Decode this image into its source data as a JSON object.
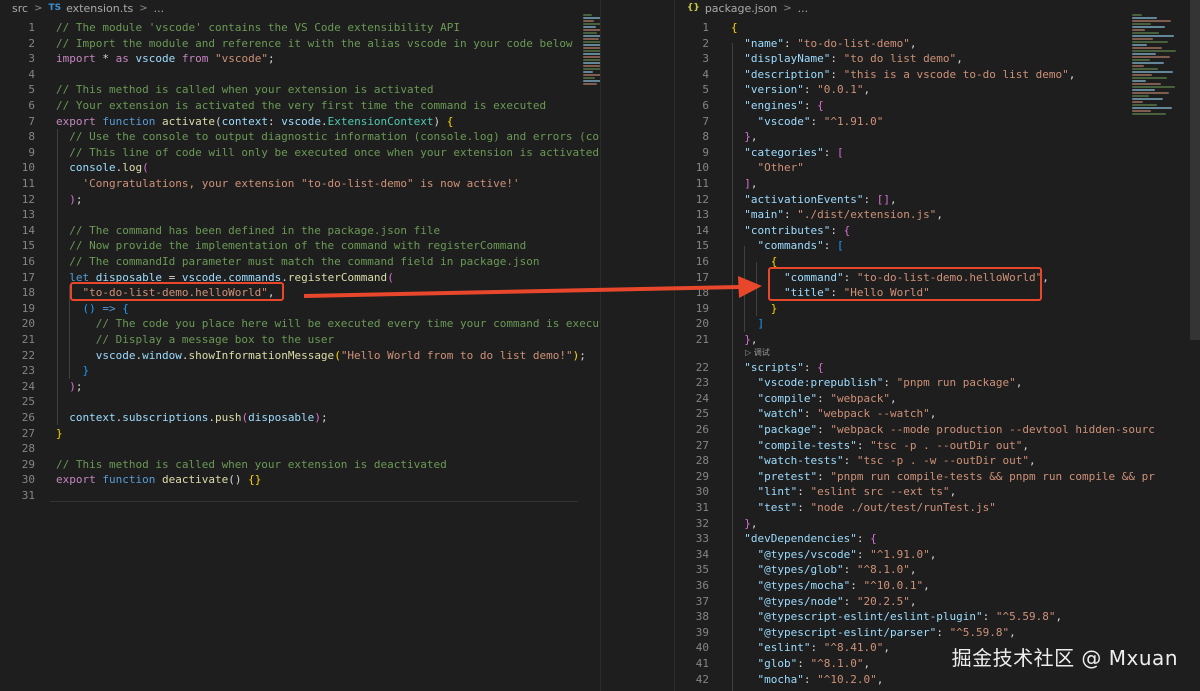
{
  "left": {
    "breadcrumb": {
      "folder": "src",
      "lang": "TS",
      "file": "extension.ts",
      "more": "..."
    },
    "lines": [
      {
        "n": "1",
        "tokens": [
          [
            "c",
            "// The module 'vscode' contains the VS Code extensibility API"
          ]
        ]
      },
      {
        "n": "2",
        "tokens": [
          [
            "c",
            "// Import the module and reference it with the alias vscode in your code below"
          ]
        ]
      },
      {
        "n": "3",
        "tokens": [
          [
            "k2",
            "import"
          ],
          [
            "p",
            " * "
          ],
          [
            "k2",
            "as"
          ],
          [
            "v",
            " vscode "
          ],
          [
            "k2",
            "from"
          ],
          [
            "s",
            " \"vscode\""
          ],
          [
            "p",
            ";"
          ]
        ]
      },
      {
        "n": "4",
        "tokens": []
      },
      {
        "n": "5",
        "tokens": [
          [
            "c",
            "// This method is called when your extension is activated"
          ]
        ]
      },
      {
        "n": "6",
        "tokens": [
          [
            "c",
            "// Your extension is activated the very first time the command is executed"
          ]
        ]
      },
      {
        "n": "7",
        "tokens": [
          [
            "k2",
            "export"
          ],
          [
            "k",
            " function"
          ],
          [
            "f",
            " activate"
          ],
          [
            "p",
            "("
          ],
          [
            "v",
            "context"
          ],
          [
            "p",
            ": "
          ],
          [
            "v",
            "vscode"
          ],
          [
            "p",
            "."
          ],
          [
            "t",
            "ExtensionContext"
          ],
          [
            "p",
            ") "
          ],
          [
            "b1",
            "{"
          ]
        ]
      },
      {
        "n": "8",
        "tokens": [
          [
            "c",
            "  // Use the console to output diagnostic information (console.log) and errors (cons"
          ]
        ]
      },
      {
        "n": "9",
        "tokens": [
          [
            "c",
            "  // This line of code will only be executed once when your extension is activated"
          ]
        ]
      },
      {
        "n": "10",
        "tokens": [
          [
            "v",
            "  console"
          ],
          [
            "p",
            "."
          ],
          [
            "f",
            "log"
          ],
          [
            "b2",
            "("
          ]
        ]
      },
      {
        "n": "11",
        "tokens": [
          [
            "s",
            "    'Congratulations, your extension \"to-do-list-demo\" is now active!'"
          ]
        ]
      },
      {
        "n": "12",
        "tokens": [
          [
            "b2",
            "  )"
          ],
          [
            "p",
            ";"
          ]
        ]
      },
      {
        "n": "13",
        "tokens": []
      },
      {
        "n": "14",
        "tokens": [
          [
            "c",
            "  // The command has been defined in the package.json file"
          ]
        ]
      },
      {
        "n": "15",
        "tokens": [
          [
            "c",
            "  // Now provide the implementation of the command with registerCommand"
          ]
        ]
      },
      {
        "n": "16",
        "tokens": [
          [
            "c",
            "  // The commandId parameter must match the command field in package.json"
          ]
        ]
      },
      {
        "n": "17",
        "tokens": [
          [
            "k",
            "  let"
          ],
          [
            "v",
            " disposable"
          ],
          [
            "p",
            " = "
          ],
          [
            "v",
            "vscode"
          ],
          [
            "p",
            "."
          ],
          [
            "v",
            "commands"
          ],
          [
            "p",
            "."
          ],
          [
            "f",
            "registerCommand"
          ],
          [
            "b2",
            "("
          ]
        ]
      },
      {
        "n": "18",
        "tokens": [
          [
            "s",
            "    \"to-do-list-demo.helloWorld\""
          ],
          [
            "p",
            ","
          ]
        ]
      },
      {
        "n": "19",
        "tokens": [
          [
            "b3",
            "    ()"
          ],
          [
            "k",
            " =>"
          ],
          [
            "b3",
            " {"
          ]
        ]
      },
      {
        "n": "20",
        "tokens": [
          [
            "c",
            "      // The code you place here will be executed every time your command is execute"
          ]
        ]
      },
      {
        "n": "21",
        "tokens": [
          [
            "c",
            "      // Display a message box to the user"
          ]
        ]
      },
      {
        "n": "22",
        "tokens": [
          [
            "v",
            "      vscode"
          ],
          [
            "p",
            "."
          ],
          [
            "v",
            "window"
          ],
          [
            "p",
            "."
          ],
          [
            "f",
            "showInformationMessage"
          ],
          [
            "b1",
            "("
          ],
          [
            "s",
            "\"Hello World from to do list demo!\""
          ],
          [
            "b1",
            ")"
          ],
          [
            "p",
            ";"
          ]
        ]
      },
      {
        "n": "23",
        "tokens": [
          [
            "b3",
            "    }"
          ]
        ]
      },
      {
        "n": "24",
        "tokens": [
          [
            "b2",
            "  )"
          ],
          [
            "p",
            ";"
          ]
        ]
      },
      {
        "n": "25",
        "tokens": []
      },
      {
        "n": "26",
        "tokens": [
          [
            "v",
            "  context"
          ],
          [
            "p",
            "."
          ],
          [
            "v",
            "subscriptions"
          ],
          [
            "p",
            "."
          ],
          [
            "f",
            "push"
          ],
          [
            "b2",
            "("
          ],
          [
            "v",
            "disposable"
          ],
          [
            "b2",
            ")"
          ],
          [
            "p",
            ";"
          ]
        ]
      },
      {
        "n": "27",
        "tokens": [
          [
            "b1",
            "}"
          ]
        ]
      },
      {
        "n": "28",
        "tokens": []
      },
      {
        "n": "29",
        "tokens": [
          [
            "c",
            "// This method is called when your extension is deactivated"
          ]
        ]
      },
      {
        "n": "30",
        "tokens": [
          [
            "k2",
            "export"
          ],
          [
            "k",
            " function"
          ],
          [
            "f",
            " deactivate"
          ],
          [
            "p",
            "() "
          ],
          [
            "b1",
            "{}"
          ]
        ]
      },
      {
        "n": "31",
        "tokens": []
      }
    ]
  },
  "right": {
    "breadcrumb": {
      "lang": "{}",
      "file": "package.json",
      "more": "..."
    },
    "codelens": "▷ 调试",
    "lines": [
      {
        "n": "1",
        "tokens": [
          [
            "b1",
            "{"
          ]
        ]
      },
      {
        "n": "2",
        "tokens": [
          [
            "y",
            "  \"name\""
          ],
          [
            "p",
            ": "
          ],
          [
            "s",
            "\"to-do-list-demo\""
          ],
          [
            "p",
            ","
          ]
        ]
      },
      {
        "n": "3",
        "tokens": [
          [
            "y",
            "  \"displayName\""
          ],
          [
            "p",
            ": "
          ],
          [
            "s",
            "\"to do list demo\""
          ],
          [
            "p",
            ","
          ]
        ]
      },
      {
        "n": "4",
        "tokens": [
          [
            "y",
            "  \"description\""
          ],
          [
            "p",
            ": "
          ],
          [
            "s",
            "\"this is a vscode to-do list demo\""
          ],
          [
            "p",
            ","
          ]
        ]
      },
      {
        "n": "5",
        "tokens": [
          [
            "y",
            "  \"version\""
          ],
          [
            "p",
            ": "
          ],
          [
            "s",
            "\"0.0.1\""
          ],
          [
            "p",
            ","
          ]
        ]
      },
      {
        "n": "6",
        "tokens": [
          [
            "y",
            "  \"engines\""
          ],
          [
            "p",
            ": "
          ],
          [
            "b2",
            "{"
          ]
        ]
      },
      {
        "n": "7",
        "tokens": [
          [
            "y",
            "    \"vscode\""
          ],
          [
            "p",
            ": "
          ],
          [
            "s",
            "\"^1.91.0\""
          ]
        ]
      },
      {
        "n": "8",
        "tokens": [
          [
            "b2",
            "  }"
          ],
          [
            "p",
            ","
          ]
        ]
      },
      {
        "n": "9",
        "tokens": [
          [
            "y",
            "  \"categories\""
          ],
          [
            "p",
            ": "
          ],
          [
            "b2",
            "["
          ]
        ]
      },
      {
        "n": "10",
        "tokens": [
          [
            "s",
            "    \"Other\""
          ]
        ]
      },
      {
        "n": "11",
        "tokens": [
          [
            "b2",
            "  ]"
          ],
          [
            "p",
            ","
          ]
        ]
      },
      {
        "n": "12",
        "tokens": [
          [
            "y",
            "  \"activationEvents\""
          ],
          [
            "p",
            ": "
          ],
          [
            "b2",
            "[]"
          ],
          [
            "p",
            ","
          ]
        ]
      },
      {
        "n": "13",
        "tokens": [
          [
            "y",
            "  \"main\""
          ],
          [
            "p",
            ": "
          ],
          [
            "s",
            "\"./dist/extension.js\""
          ],
          [
            "p",
            ","
          ]
        ]
      },
      {
        "n": "14",
        "tokens": [
          [
            "y",
            "  \"contributes\""
          ],
          [
            "p",
            ": "
          ],
          [
            "b2",
            "{"
          ]
        ]
      },
      {
        "n": "15",
        "tokens": [
          [
            "y",
            "    \"commands\""
          ],
          [
            "p",
            ": "
          ],
          [
            "b3",
            "["
          ]
        ]
      },
      {
        "n": "16",
        "tokens": [
          [
            "b1",
            "      {"
          ]
        ]
      },
      {
        "n": "17",
        "tokens": [
          [
            "y",
            "        \"command\""
          ],
          [
            "p",
            ": "
          ],
          [
            "s",
            "\"to-do-list-demo.helloWorld\""
          ],
          [
            "p",
            ","
          ]
        ]
      },
      {
        "n": "18",
        "tokens": [
          [
            "y",
            "        \"title\""
          ],
          [
            "p",
            ": "
          ],
          [
            "s",
            "\"Hello World\""
          ]
        ]
      },
      {
        "n": "19",
        "tokens": [
          [
            "b1",
            "      }"
          ]
        ]
      },
      {
        "n": "20",
        "tokens": [
          [
            "b3",
            "    ]"
          ]
        ]
      },
      {
        "n": "21",
        "tokens": [
          [
            "b2",
            "  }"
          ],
          [
            "p",
            ","
          ]
        ]
      },
      {
        "n": "22",
        "tokens": [
          [
            "y",
            "  \"scripts\""
          ],
          [
            "p",
            ": "
          ],
          [
            "b2",
            "{"
          ]
        ]
      },
      {
        "n": "23",
        "tokens": [
          [
            "y",
            "    \"vscode:prepublish\""
          ],
          [
            "p",
            ": "
          ],
          [
            "s",
            "\"pnpm run package\""
          ],
          [
            "p",
            ","
          ]
        ]
      },
      {
        "n": "24",
        "tokens": [
          [
            "y",
            "    \"compile\""
          ],
          [
            "p",
            ": "
          ],
          [
            "s",
            "\"webpack\""
          ],
          [
            "p",
            ","
          ]
        ]
      },
      {
        "n": "25",
        "tokens": [
          [
            "y",
            "    \"watch\""
          ],
          [
            "p",
            ": "
          ],
          [
            "s",
            "\"webpack --watch\""
          ],
          [
            "p",
            ","
          ]
        ]
      },
      {
        "n": "26",
        "tokens": [
          [
            "y",
            "    \"package\""
          ],
          [
            "p",
            ": "
          ],
          [
            "s",
            "\"webpack --mode production --devtool hidden-sourc"
          ]
        ]
      },
      {
        "n": "27",
        "tokens": [
          [
            "y",
            "    \"compile-tests\""
          ],
          [
            "p",
            ": "
          ],
          [
            "s",
            "\"tsc -p . --outDir out\""
          ],
          [
            "p",
            ","
          ]
        ]
      },
      {
        "n": "28",
        "tokens": [
          [
            "y",
            "    \"watch-tests\""
          ],
          [
            "p",
            ": "
          ],
          [
            "s",
            "\"tsc -p . -w --outDir out\""
          ],
          [
            "p",
            ","
          ]
        ]
      },
      {
        "n": "29",
        "tokens": [
          [
            "y",
            "    \"pretest\""
          ],
          [
            "p",
            ": "
          ],
          [
            "s",
            "\"pnpm run compile-tests && pnpm run compile && pr"
          ]
        ]
      },
      {
        "n": "30",
        "tokens": [
          [
            "y",
            "    \"lint\""
          ],
          [
            "p",
            ": "
          ],
          [
            "s",
            "\"eslint src --ext ts\""
          ],
          [
            "p",
            ","
          ]
        ]
      },
      {
        "n": "31",
        "tokens": [
          [
            "y",
            "    \"test\""
          ],
          [
            "p",
            ": "
          ],
          [
            "s",
            "\"node ./out/test/runTest.js\""
          ]
        ]
      },
      {
        "n": "32",
        "tokens": [
          [
            "b2",
            "  }"
          ],
          [
            "p",
            ","
          ]
        ]
      },
      {
        "n": "33",
        "tokens": [
          [
            "y",
            "  \"devDependencies\""
          ],
          [
            "p",
            ": "
          ],
          [
            "b2",
            "{"
          ]
        ]
      },
      {
        "n": "34",
        "tokens": [
          [
            "y",
            "    \"@types/vscode\""
          ],
          [
            "p",
            ": "
          ],
          [
            "s",
            "\"^1.91.0\""
          ],
          [
            "p",
            ","
          ]
        ]
      },
      {
        "n": "35",
        "tokens": [
          [
            "y",
            "    \"@types/glob\""
          ],
          [
            "p",
            ": "
          ],
          [
            "s",
            "\"^8.1.0\""
          ],
          [
            "p",
            ","
          ]
        ]
      },
      {
        "n": "36",
        "tokens": [
          [
            "y",
            "    \"@types/mocha\""
          ],
          [
            "p",
            ": "
          ],
          [
            "s",
            "\"^10.0.1\""
          ],
          [
            "p",
            ","
          ]
        ]
      },
      {
        "n": "37",
        "tokens": [
          [
            "y",
            "    \"@types/node\""
          ],
          [
            "p",
            ": "
          ],
          [
            "s",
            "\"20.2.5\""
          ],
          [
            "p",
            ","
          ]
        ]
      },
      {
        "n": "38",
        "tokens": [
          [
            "y",
            "    \"@typescript-eslint/eslint-plugin\""
          ],
          [
            "p",
            ": "
          ],
          [
            "s",
            "\"^5.59.8\""
          ],
          [
            "p",
            ","
          ]
        ]
      },
      {
        "n": "39",
        "tokens": [
          [
            "y",
            "    \"@typescript-eslint/parser\""
          ],
          [
            "p",
            ": "
          ],
          [
            "s",
            "\"^5.59.8\""
          ],
          [
            "p",
            ","
          ]
        ]
      },
      {
        "n": "40",
        "tokens": [
          [
            "y",
            "    \"eslint\""
          ],
          [
            "p",
            ": "
          ],
          [
            "s",
            "\"^8.41.0\""
          ],
          [
            "p",
            ","
          ]
        ]
      },
      {
        "n": "41",
        "tokens": [
          [
            "y",
            "    \"glob\""
          ],
          [
            "p",
            ": "
          ],
          [
            "s",
            "\"^8.1.0\""
          ],
          [
            "p",
            ","
          ]
        ]
      },
      {
        "n": "42",
        "tokens": [
          [
            "y",
            "    \"mocha\""
          ],
          [
            "p",
            ": "
          ],
          [
            "s",
            "\"^10.2.0\""
          ],
          [
            "p",
            ","
          ]
        ]
      }
    ]
  },
  "watermark": "掘金技术社区 @ Mxuan",
  "colors": {
    "annotation": "#e8472b",
    "background": "#1e1e1e"
  }
}
